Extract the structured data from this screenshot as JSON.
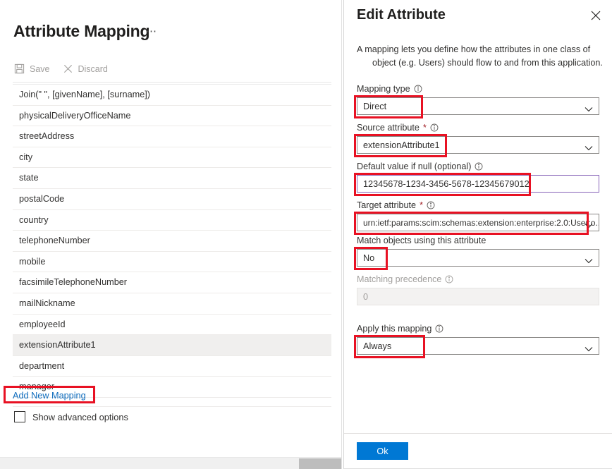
{
  "left": {
    "title": "Attribute Mapping",
    "ellipsis": "⋯",
    "toolbar": {
      "save_label": "Save",
      "discard_label": "Discard"
    },
    "attributes": [
      "Join(\" \", [givenName], [surname])",
      "physicalDeliveryOfficeName",
      "streetAddress",
      "city",
      "state",
      "postalCode",
      "country",
      "telephoneNumber",
      "mobile",
      "facsimileTelephoneNumber",
      "mailNickname",
      "employeeId",
      "extensionAttribute1",
      "department",
      "manager"
    ],
    "selected_attribute": "extensionAttribute1",
    "add_new_mapping": "Add New Mapping",
    "show_advanced_options": "Show advanced options",
    "advanced_checked": false
  },
  "panel": {
    "title": "Edit Attribute",
    "description_line1": "A mapping lets you define how the attributes in one class of",
    "description_line2": "object (e.g. Users) should flow to and from this application.",
    "fields": {
      "mapping_type": {
        "label": "Mapping type",
        "value": "Direct",
        "has_info": true,
        "required": false
      },
      "source_attribute": {
        "label": "Source attribute",
        "value": "extensionAttribute1",
        "has_info": true,
        "required": true
      },
      "default_value": {
        "label": "Default value if null (optional)",
        "value": "12345678-1234-3456-5678-12345679012",
        "has_info": true,
        "required": false
      },
      "target_attribute": {
        "label": "Target attribute",
        "value": "urn:ietf:params:scim:schemas:extension:enterprise:2.0:User:o...",
        "has_info": true,
        "required": true
      },
      "match_objects": {
        "label": "Match objects using this attribute",
        "value": "No",
        "has_info": false,
        "required": false
      },
      "matching_precedence": {
        "label": "Matching precedence",
        "value": "0",
        "has_info": true,
        "required": false,
        "disabled": true
      },
      "apply_mapping": {
        "label": "Apply this mapping",
        "value": "Always",
        "has_info": true,
        "required": false
      }
    },
    "ok_button": "Ok"
  },
  "colors": {
    "accent": "#0078d4",
    "highlight": "#e81123",
    "link": "#0f6cbd",
    "focus_border": "#8764b8",
    "selected_row": "#f0efee"
  }
}
